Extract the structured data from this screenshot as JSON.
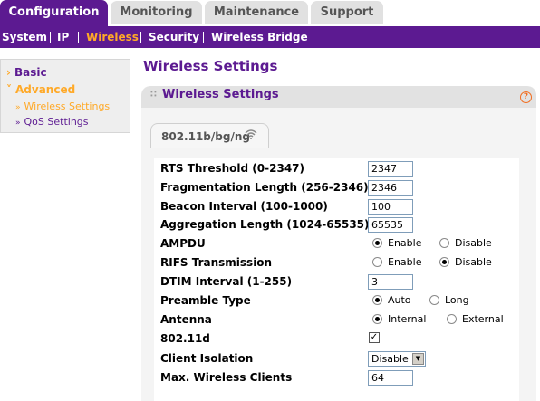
{
  "top_tabs": [
    {
      "label": "Configuration",
      "active": true
    },
    {
      "label": "Monitoring",
      "active": false
    },
    {
      "label": "Maintenance",
      "active": false
    },
    {
      "label": "Support",
      "active": false
    }
  ],
  "subnav": [
    {
      "label": "System",
      "active": false
    },
    {
      "label": "IP",
      "active": false
    },
    {
      "label": "Wireless",
      "active": true
    },
    {
      "label": "Security",
      "active": false
    },
    {
      "label": "Wireless Bridge",
      "active": false
    }
  ],
  "leftnav": {
    "basic": "Basic",
    "advanced": "Advanced",
    "wireless_settings": "Wireless Settings",
    "qos_settings": "QoS Settings"
  },
  "page_title": "Wireless Settings",
  "section_title": "Wireless Settings",
  "mode_tab": "802.11b/bg/ng",
  "form": {
    "rts_threshold": {
      "label": "RTS Threshold (0-2347)",
      "value": "2347"
    },
    "fragmentation_length": {
      "label": "Fragmentation Length (256-2346)",
      "value": "2346"
    },
    "beacon_interval": {
      "label": "Beacon Interval (100-1000)",
      "value": "100"
    },
    "aggregation_length": {
      "label": "Aggregation Length (1024-65535)",
      "value": "65535"
    },
    "ampdu": {
      "label": "AMPDU",
      "option1": "Enable",
      "option2": "Disable",
      "selected": "Enable"
    },
    "rifs": {
      "label": "RIFS Transmission",
      "option1": "Enable",
      "option2": "Disable",
      "selected": "Disable"
    },
    "dtim_interval": {
      "label": "DTIM Interval (1-255)",
      "value": "3"
    },
    "preamble": {
      "label": "Preamble Type",
      "option1": "Auto",
      "option2": "Long",
      "selected": "Auto"
    },
    "antenna": {
      "label": "Antenna",
      "option1": "Internal",
      "option2": "External",
      "selected": "Internal"
    },
    "dot11d": {
      "label": "802.11d",
      "checked": true
    },
    "client_isolation": {
      "label": "Client Isolation",
      "value": "Disable"
    },
    "max_clients": {
      "label": "Max. Wireless Clients",
      "value": "64"
    }
  },
  "colors": {
    "brand_purple": "#5c1a91",
    "active_orange": "#ffa927",
    "help_orange": "#f26c1d"
  },
  "icons": [
    "help-icon",
    "wifi-icon",
    "chevron-right-icon",
    "chevron-down-icon",
    "dropdown-arrow-icon"
  ]
}
